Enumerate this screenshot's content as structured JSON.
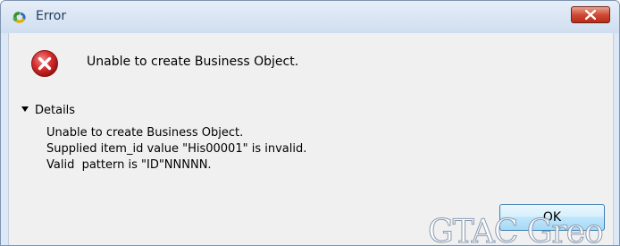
{
  "window": {
    "title": "Error"
  },
  "message": {
    "main": "Unable to create Business Object."
  },
  "details": {
    "toggle_label": "Details",
    "lines": [
      "Unable to create Business Object.",
      "Supplied item_id value \"His00001\" is invalid.",
      "Valid  pattern is \"ID\"NNNNN."
    ]
  },
  "buttons": {
    "ok_label": "OK"
  },
  "watermark": {
    "text": "GTAC Greo"
  },
  "colors": {
    "error_red": "#d62e2e",
    "close_button_red": "#cf4b36",
    "ok_button_border": "#3c7fb1"
  }
}
